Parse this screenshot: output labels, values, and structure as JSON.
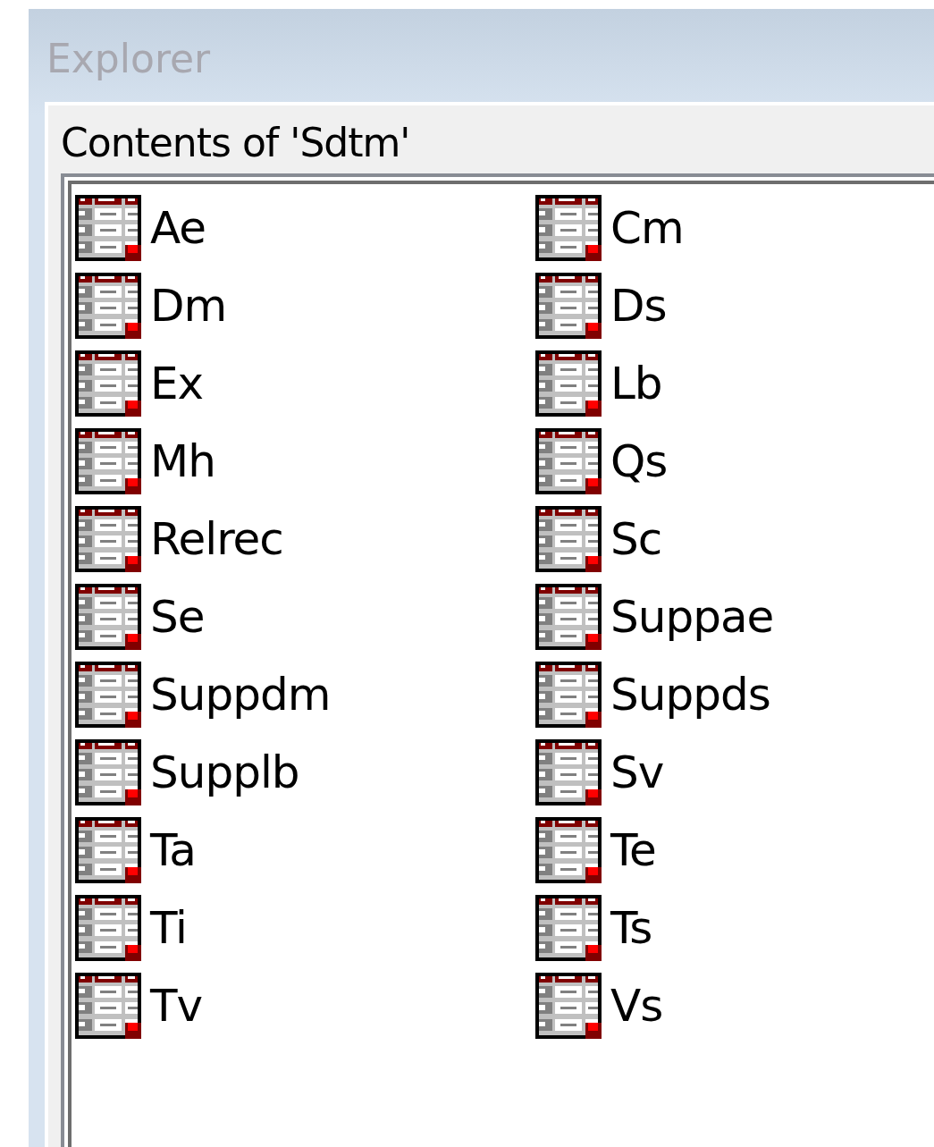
{
  "window": {
    "title": "Explorer"
  },
  "panel": {
    "title": "Contents of 'Sdtm'"
  },
  "items": [
    {
      "label": "Ae"
    },
    {
      "label": "Cm"
    },
    {
      "label": "Dm"
    },
    {
      "label": "Ds"
    },
    {
      "label": "Ex"
    },
    {
      "label": "Lb"
    },
    {
      "label": "Mh"
    },
    {
      "label": "Qs"
    },
    {
      "label": "Relrec"
    },
    {
      "label": "Sc"
    },
    {
      "label": "Se"
    },
    {
      "label": "Suppae"
    },
    {
      "label": "Suppdm"
    },
    {
      "label": "Suppds"
    },
    {
      "label": "Supplb"
    },
    {
      "label": "Sv"
    },
    {
      "label": "Ta"
    },
    {
      "label": "Te"
    },
    {
      "label": "Ti"
    },
    {
      "label": "Ts"
    },
    {
      "label": "Tv"
    },
    {
      "label": "Vs"
    }
  ]
}
